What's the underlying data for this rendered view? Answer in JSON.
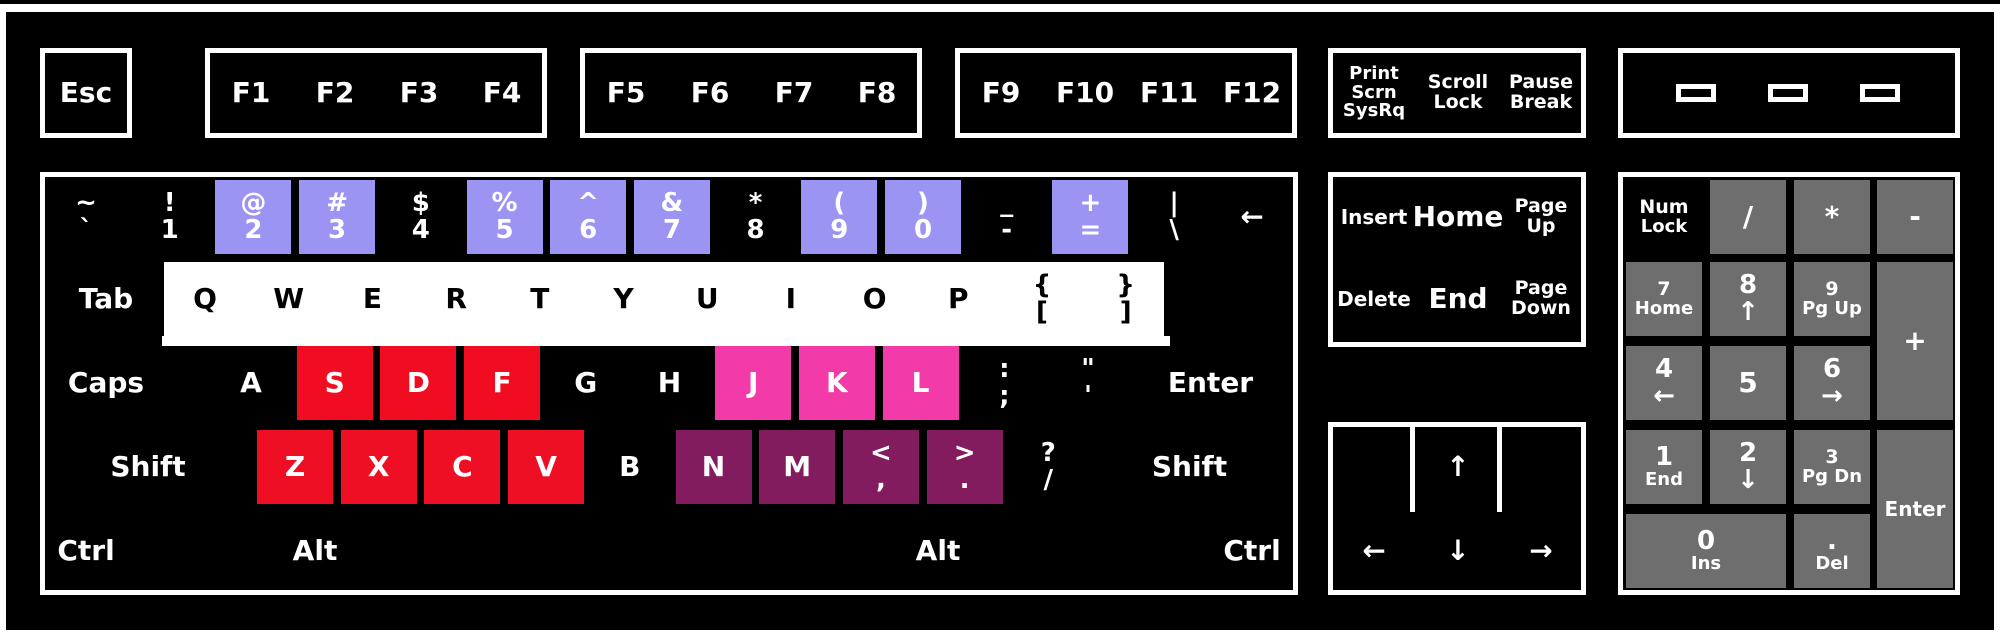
{
  "colors": {
    "background": "#000000",
    "outline": "#ffffff",
    "default_key": "#000000",
    "default_text": "#ffffff",
    "numpad_key": "#6e6e6e",
    "number_row_highlight": "#9b94f2",
    "home_left": "#f00d22",
    "home_right": "#f23aa8",
    "bottom_left": "#ef0f24",
    "bottom_right": "#831c5e",
    "top_letter_row": "#ffffff",
    "top_letter_text": "#000000"
  },
  "keys": [
    {
      "id": "esc",
      "label": "Esc",
      "fill": "default_key"
    },
    {
      "id": "f1",
      "label": "F1",
      "fill": "default_key"
    },
    {
      "id": "f2",
      "label": "F2",
      "fill": "default_key"
    },
    {
      "id": "f3",
      "label": "F3",
      "fill": "default_key"
    },
    {
      "id": "f4",
      "label": "F4",
      "fill": "default_key"
    },
    {
      "id": "f5",
      "label": "F5",
      "fill": "default_key"
    },
    {
      "id": "f6",
      "label": "F6",
      "fill": "default_key"
    },
    {
      "id": "f7",
      "label": "F7",
      "fill": "default_key"
    },
    {
      "id": "f8",
      "label": "F8",
      "fill": "default_key"
    },
    {
      "id": "f9",
      "label": "F9",
      "fill": "default_key"
    },
    {
      "id": "f10",
      "label": "F10",
      "fill": "default_key"
    },
    {
      "id": "f11",
      "label": "F11",
      "fill": "default_key"
    },
    {
      "id": "f12",
      "label": "F12",
      "fill": "default_key"
    },
    {
      "id": "print-screen",
      "label": "Print\nScrn\nSysRq",
      "fill": "default_key"
    },
    {
      "id": "scroll-lock",
      "label": "Scroll\nLock",
      "fill": "default_key"
    },
    {
      "id": "pause-break",
      "label": "Pause\nBreak",
      "fill": "default_key"
    },
    {
      "id": "tilde",
      "label": "~\n`",
      "fill": "default_key"
    },
    {
      "id": "digit-1",
      "label": "!\n1",
      "fill": "default_key"
    },
    {
      "id": "digit-2",
      "label": "@\n2",
      "fill": "number_row_highlight"
    },
    {
      "id": "digit-3",
      "label": "#\n3",
      "fill": "number_row_highlight"
    },
    {
      "id": "digit-4",
      "label": "$\n4",
      "fill": "default_key"
    },
    {
      "id": "digit-5",
      "label": "%\n5",
      "fill": "number_row_highlight"
    },
    {
      "id": "digit-6",
      "label": "^\n6",
      "fill": "number_row_highlight"
    },
    {
      "id": "digit-7",
      "label": "&\n7",
      "fill": "number_row_highlight"
    },
    {
      "id": "digit-8",
      "label": "*\n8",
      "fill": "default_key"
    },
    {
      "id": "digit-9",
      "label": "(\n9",
      "fill": "number_row_highlight"
    },
    {
      "id": "digit-0",
      "label": ")\n0",
      "fill": "number_row_highlight"
    },
    {
      "id": "minus",
      "label": "_\n-",
      "fill": "default_key"
    },
    {
      "id": "equals",
      "label": "+\n=",
      "fill": "number_row_highlight"
    },
    {
      "id": "backslash",
      "label": "|\n\\",
      "fill": "default_key"
    },
    {
      "id": "backspace",
      "label": "←",
      "fill": "default_key"
    },
    {
      "id": "tab",
      "label": "Tab",
      "fill": "default_key"
    },
    {
      "id": "q",
      "label": "Q",
      "fill": "top_letter_row"
    },
    {
      "id": "w",
      "label": "W",
      "fill": "top_letter_row"
    },
    {
      "id": "e",
      "label": "E",
      "fill": "top_letter_row"
    },
    {
      "id": "r",
      "label": "R",
      "fill": "top_letter_row"
    },
    {
      "id": "t",
      "label": "T",
      "fill": "top_letter_row"
    },
    {
      "id": "y",
      "label": "Y",
      "fill": "top_letter_row"
    },
    {
      "id": "u",
      "label": "U",
      "fill": "top_letter_row"
    },
    {
      "id": "i",
      "label": "I",
      "fill": "top_letter_row"
    },
    {
      "id": "o",
      "label": "O",
      "fill": "top_letter_row"
    },
    {
      "id": "p",
      "label": "P",
      "fill": "top_letter_row"
    },
    {
      "id": "bracket-left",
      "label": "{\n[",
      "fill": "top_letter_row"
    },
    {
      "id": "bracket-right",
      "label": "}\n]",
      "fill": "top_letter_row"
    },
    {
      "id": "caps",
      "label": "Caps",
      "fill": "default_key"
    },
    {
      "id": "a",
      "label": "A",
      "fill": "default_key"
    },
    {
      "id": "s",
      "label": "S",
      "fill": "home_left"
    },
    {
      "id": "d",
      "label": "D",
      "fill": "home_left"
    },
    {
      "id": "f",
      "label": "F",
      "fill": "home_left"
    },
    {
      "id": "g",
      "label": "G",
      "fill": "default_key"
    },
    {
      "id": "h",
      "label": "H",
      "fill": "default_key"
    },
    {
      "id": "j",
      "label": "J",
      "fill": "home_right"
    },
    {
      "id": "k",
      "label": "K",
      "fill": "home_right"
    },
    {
      "id": "l",
      "label": "L",
      "fill": "home_right"
    },
    {
      "id": "semicolon",
      "label": ":\n;",
      "fill": "default_key"
    },
    {
      "id": "quote",
      "label": "\"\n'",
      "fill": "default_key"
    },
    {
      "id": "enter",
      "label": "Enter",
      "fill": "default_key"
    },
    {
      "id": "shift-left",
      "label": "Shift",
      "fill": "default_key"
    },
    {
      "id": "z",
      "label": "Z",
      "fill": "bottom_left"
    },
    {
      "id": "x",
      "label": "X",
      "fill": "bottom_left"
    },
    {
      "id": "c",
      "label": "C",
      "fill": "bottom_left"
    },
    {
      "id": "v",
      "label": "V",
      "fill": "bottom_left"
    },
    {
      "id": "b",
      "label": "B",
      "fill": "default_key"
    },
    {
      "id": "n",
      "label": "N",
      "fill": "bottom_right"
    },
    {
      "id": "m",
      "label": "M",
      "fill": "bottom_right"
    },
    {
      "id": "comma",
      "label": "<\n,",
      "fill": "bottom_right"
    },
    {
      "id": "period",
      "label": ">\n.",
      "fill": "bottom_right"
    },
    {
      "id": "slash",
      "label": "?\n/",
      "fill": "default_key"
    },
    {
      "id": "shift-right",
      "label": "Shift",
      "fill": "default_key"
    },
    {
      "id": "ctrl-left",
      "label": "Ctrl",
      "fill": "default_key"
    },
    {
      "id": "alt-left",
      "label": "Alt",
      "fill": "default_key"
    },
    {
      "id": "alt-right",
      "label": "Alt",
      "fill": "default_key"
    },
    {
      "id": "ctrl-right",
      "label": "Ctrl",
      "fill": "default_key"
    },
    {
      "id": "insert",
      "label": "Insert",
      "fill": "default_key"
    },
    {
      "id": "home",
      "label": "Home",
      "fill": "default_key"
    },
    {
      "id": "page-up",
      "label": "Page\nUp",
      "fill": "default_key"
    },
    {
      "id": "delete",
      "label": "Delete",
      "fill": "default_key"
    },
    {
      "id": "end",
      "label": "End",
      "fill": "default_key"
    },
    {
      "id": "page-down",
      "label": "Page\nDown",
      "fill": "default_key"
    },
    {
      "id": "arrow-up",
      "label": "↑",
      "fill": "default_key"
    },
    {
      "id": "arrow-left",
      "label": "←",
      "fill": "default_key"
    },
    {
      "id": "arrow-down",
      "label": "↓",
      "fill": "default_key"
    },
    {
      "id": "arrow-right",
      "label": "→",
      "fill": "default_key"
    },
    {
      "id": "num-lock",
      "label": "Num\nLock",
      "fill": "default_key"
    },
    {
      "id": "num-divide",
      "label": "/",
      "fill": "numpad_key"
    },
    {
      "id": "num-multiply",
      "label": "*",
      "fill": "numpad_key"
    },
    {
      "id": "num-minus",
      "label": "-",
      "fill": "numpad_key"
    },
    {
      "id": "num-7",
      "label": "7\nHome",
      "fill": "numpad_key"
    },
    {
      "id": "num-8",
      "label": "8\n↑",
      "fill": "numpad_key"
    },
    {
      "id": "num-9",
      "label": "9\nPg Up",
      "fill": "numpad_key"
    },
    {
      "id": "num-plus",
      "label": "+",
      "fill": "numpad_key"
    },
    {
      "id": "num-4",
      "label": "4\n←",
      "fill": "numpad_key"
    },
    {
      "id": "num-5",
      "label": "5",
      "fill": "numpad_key"
    },
    {
      "id": "num-6",
      "label": "6\n→",
      "fill": "numpad_key"
    },
    {
      "id": "num-1",
      "label": "1\nEnd",
      "fill": "numpad_key"
    },
    {
      "id": "num-2",
      "label": "2\n↓",
      "fill": "numpad_key"
    },
    {
      "id": "num-3",
      "label": "3\nPg Dn",
      "fill": "numpad_key"
    },
    {
      "id": "num-enter",
      "label": "Enter",
      "fill": "numpad_key"
    },
    {
      "id": "num-0",
      "label": "0\nIns",
      "fill": "numpad_key"
    },
    {
      "id": "num-decimal",
      "label": ".\nDel",
      "fill": "numpad_key"
    }
  ]
}
